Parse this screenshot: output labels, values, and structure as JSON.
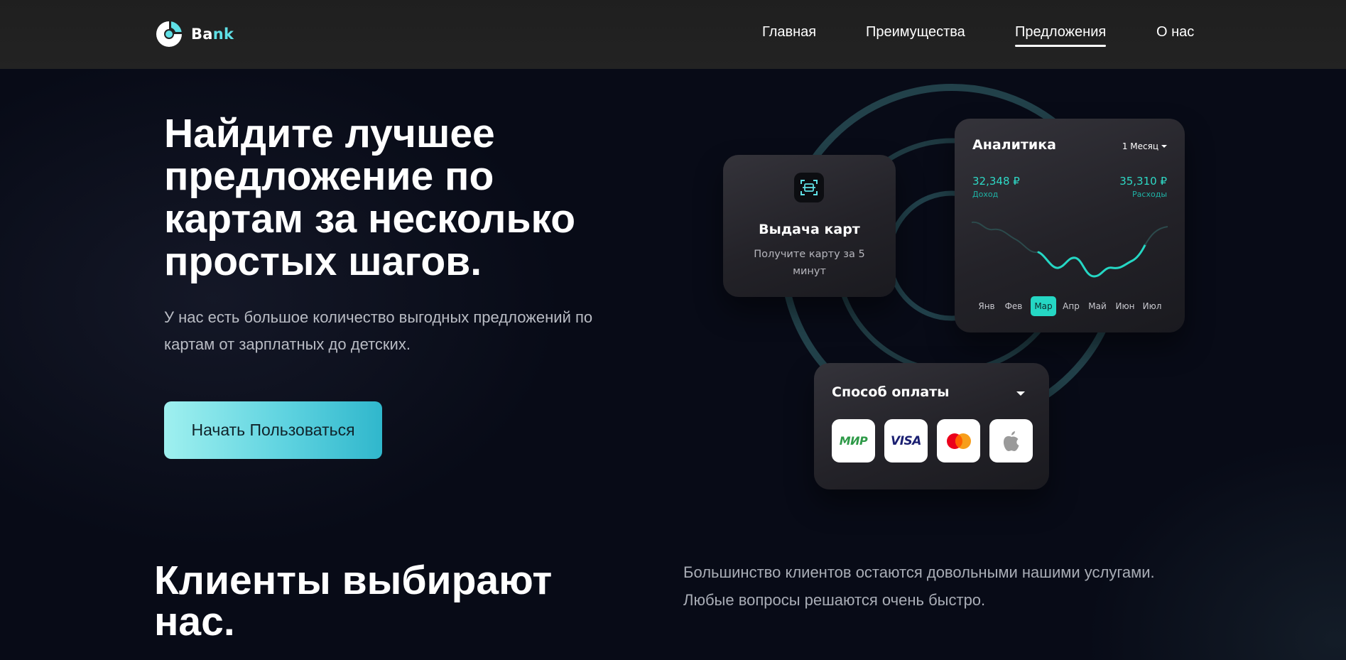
{
  "header": {
    "logo": {
      "text_part1": "Ba",
      "text_part2": "nk"
    },
    "nav": [
      {
        "label": "Главная",
        "active": false
      },
      {
        "label": "Преимущества",
        "active": false
      },
      {
        "label": "Предложения",
        "active": true
      },
      {
        "label": "О нас",
        "active": false
      }
    ]
  },
  "hero": {
    "title": "Найдите лучшее предложение по картам за несколько простых шагов.",
    "subtitle": "У нас есть большое количество выгодных предложений по картам от зарплатных до детских.",
    "cta_label": "Начать Пользоваться"
  },
  "card_issue": {
    "icon": "scan-card-icon",
    "title": "Выдача карт",
    "text": "Получите карту за 5 минут"
  },
  "analytics": {
    "title": "Аналитика",
    "period": "1 Месяц",
    "income_value": "32,348 ₽",
    "income_label": "Доход",
    "expense_value": "35,310 ₽",
    "expense_label": "Расходы",
    "months": [
      "Янв",
      "Фев",
      "Мар",
      "Апр",
      "Май",
      "Июн",
      "Июл"
    ],
    "active_month": "Мар",
    "colors": {
      "accent": "#25d7c4",
      "muted_line": "#2c4a4c"
    }
  },
  "payment": {
    "title": "Способ оплаты",
    "methods": [
      {
        "name": "МИР",
        "icon": "mir-logo"
      },
      {
        "name": "VISA",
        "icon": "visa-logo"
      },
      {
        "name": "Mastercard",
        "icon": "mastercard-logo"
      },
      {
        "name": "Apple Pay",
        "icon": "apple-logo"
      }
    ]
  },
  "clients": {
    "title": "Клиенты выбирают нас.",
    "text": "Большинство клиентов остаются довольными нашими услугами. Любые вопросы решаются очень быстро."
  },
  "colors": {
    "background": "#080b17",
    "header": "#222222",
    "brand_accent": "#5fe0e6"
  }
}
